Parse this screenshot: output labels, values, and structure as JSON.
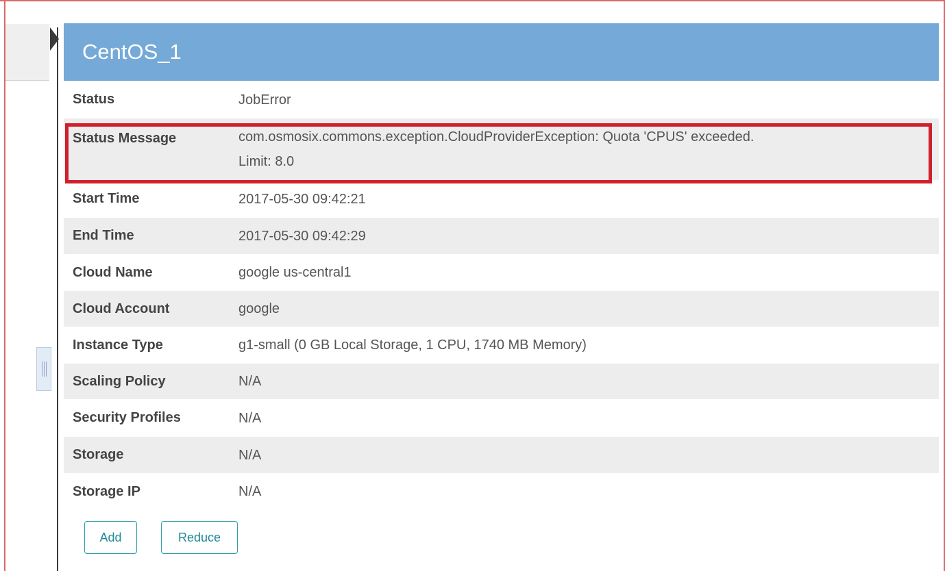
{
  "panel": {
    "title": "CentOS_1"
  },
  "details": [
    {
      "label": "Status",
      "value": "JobError"
    },
    {
      "label": "Status Message",
      "value_line1": "com.osmosix.commons.exception.CloudProviderException: Quota 'CPUS' exceeded.",
      "value_line2": "Limit: 8.0"
    },
    {
      "label": "Start Time",
      "value": "2017-05-30 09:42:21"
    },
    {
      "label": "End Time",
      "value": "2017-05-30 09:42:29"
    },
    {
      "label": "Cloud Name",
      "value": "google us-central1"
    },
    {
      "label": "Cloud Account",
      "value": "google"
    },
    {
      "label": "Instance Type",
      "value": "g1-small (0 GB Local Storage, 1 CPU, 1740 MB Memory)"
    },
    {
      "label": "Scaling Policy",
      "value": "N/A"
    },
    {
      "label": "Security Profiles",
      "value": "N/A"
    },
    {
      "label": "Storage",
      "value": "N/A"
    },
    {
      "label": "Storage IP",
      "value": "N/A"
    }
  ],
  "buttons": {
    "add": "Add",
    "reduce": "Reduce"
  },
  "colors": {
    "header": "#75a9d8",
    "highlight": "#d0202c",
    "button_accent": "#1d8a96"
  },
  "icons": {
    "collapse": "caret-right-icon",
    "handle": "drag-handle-icon"
  }
}
